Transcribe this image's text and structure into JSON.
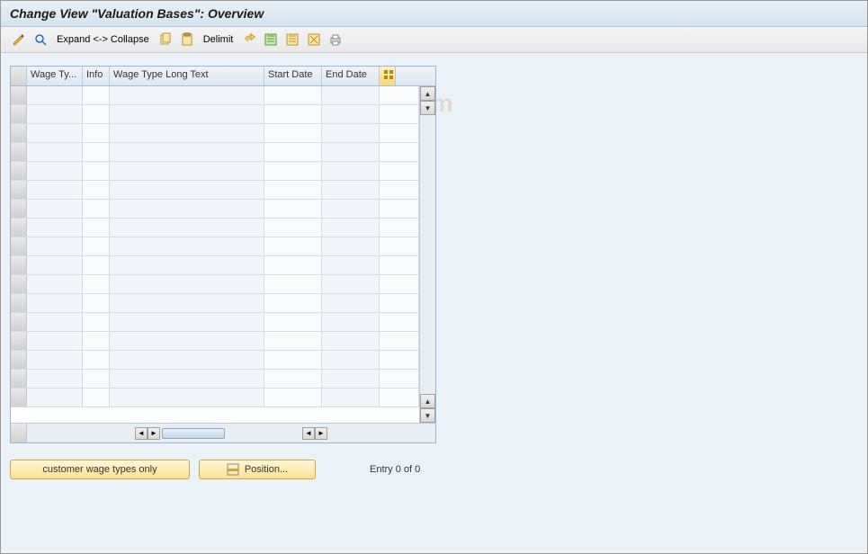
{
  "title": "Change View \"Valuation Bases\": Overview",
  "toolbar": {
    "expand_collapse_label": "Expand <-> Collapse",
    "delimit_label": "Delimit"
  },
  "table": {
    "headers": {
      "wage_type": "Wage Ty...",
      "info": "Info",
      "long_text": "Wage Type Long Text",
      "start_date": "Start Date",
      "end_date": "End Date"
    },
    "rows": []
  },
  "buttons": {
    "customer_wage_types": "customer wage types only",
    "position": "Position..."
  },
  "footer": {
    "entry_text": "Entry 0 of 0"
  },
  "row_count": 17,
  "watermark": "www.tutorialkart.com"
}
